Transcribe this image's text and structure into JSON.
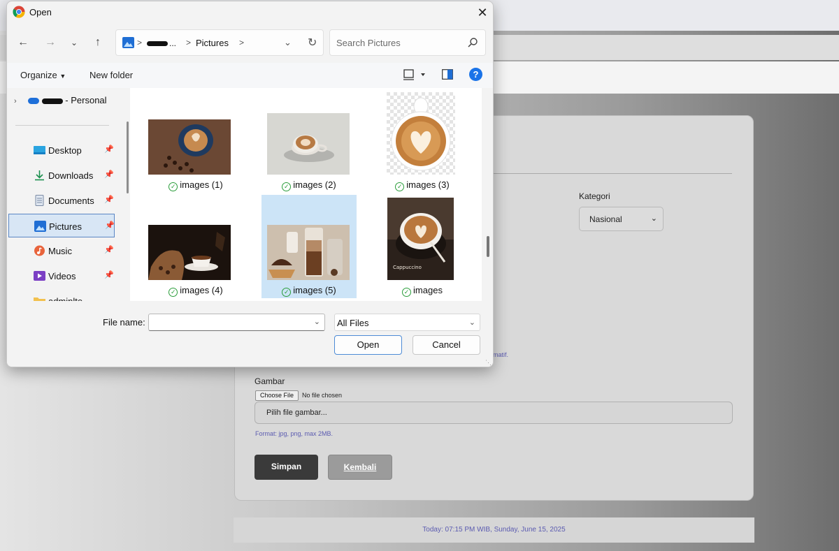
{
  "dialog": {
    "title": "Open",
    "breadcrumb": {
      "user": "...",
      "folder": "Pictures",
      "separator": ">"
    },
    "search_placeholder": "Search Pictures",
    "toolbar": {
      "organize": "Organize",
      "new_folder": "New folder",
      "help": "?"
    },
    "nav": {
      "personal": "- Personal",
      "items": [
        {
          "label": "Desktop",
          "icon": "desktop-icon",
          "pinned": true
        },
        {
          "label": "Downloads",
          "icon": "download-icon",
          "pinned": true
        },
        {
          "label": "Documents",
          "icon": "documents-icon",
          "pinned": true
        },
        {
          "label": "Pictures",
          "icon": "pictures-icon",
          "pinned": true,
          "selected": true
        },
        {
          "label": "Music",
          "icon": "music-icon",
          "pinned": true
        },
        {
          "label": "Videos",
          "icon": "videos-icon",
          "pinned": true
        },
        {
          "label": "adminlte",
          "icon": "folder-icon",
          "pinned": false
        }
      ]
    },
    "files": [
      {
        "name": "images (1)",
        "status": "synced"
      },
      {
        "name": "images (2)",
        "status": "synced"
      },
      {
        "name": "images (3)",
        "status": "synced"
      },
      {
        "name": "images (4)",
        "status": "synced"
      },
      {
        "name": "images (5)",
        "status": "synced",
        "selected": true
      },
      {
        "name": "images",
        "status": "synced",
        "thumb_text": "Cappuccino"
      }
    ],
    "filename_label": "File name:",
    "filename_value": "",
    "filetype": "All Files",
    "open_label": "Open",
    "cancel_label": "Cancel",
    "colors": {
      "accent": "#1a73e8",
      "selection": "#cce4f7",
      "synced": "#2a9d3a"
    }
  },
  "page": {
    "kategori_label": "Kategori",
    "kategori_value": "Nasional",
    "format_fragment": "matif.",
    "gambar_label": "Gambar",
    "choose_file": "Choose File",
    "no_file": "No file chosen",
    "gambar_placeholder": "Pilih file gambar...",
    "format_help": "Format: jpg, png, max 2MB.",
    "simpan": "Simpan",
    "kembali": "Kembali",
    "footer": "Today: 07:15 PM WIB, Sunday, June 15, 2025"
  }
}
